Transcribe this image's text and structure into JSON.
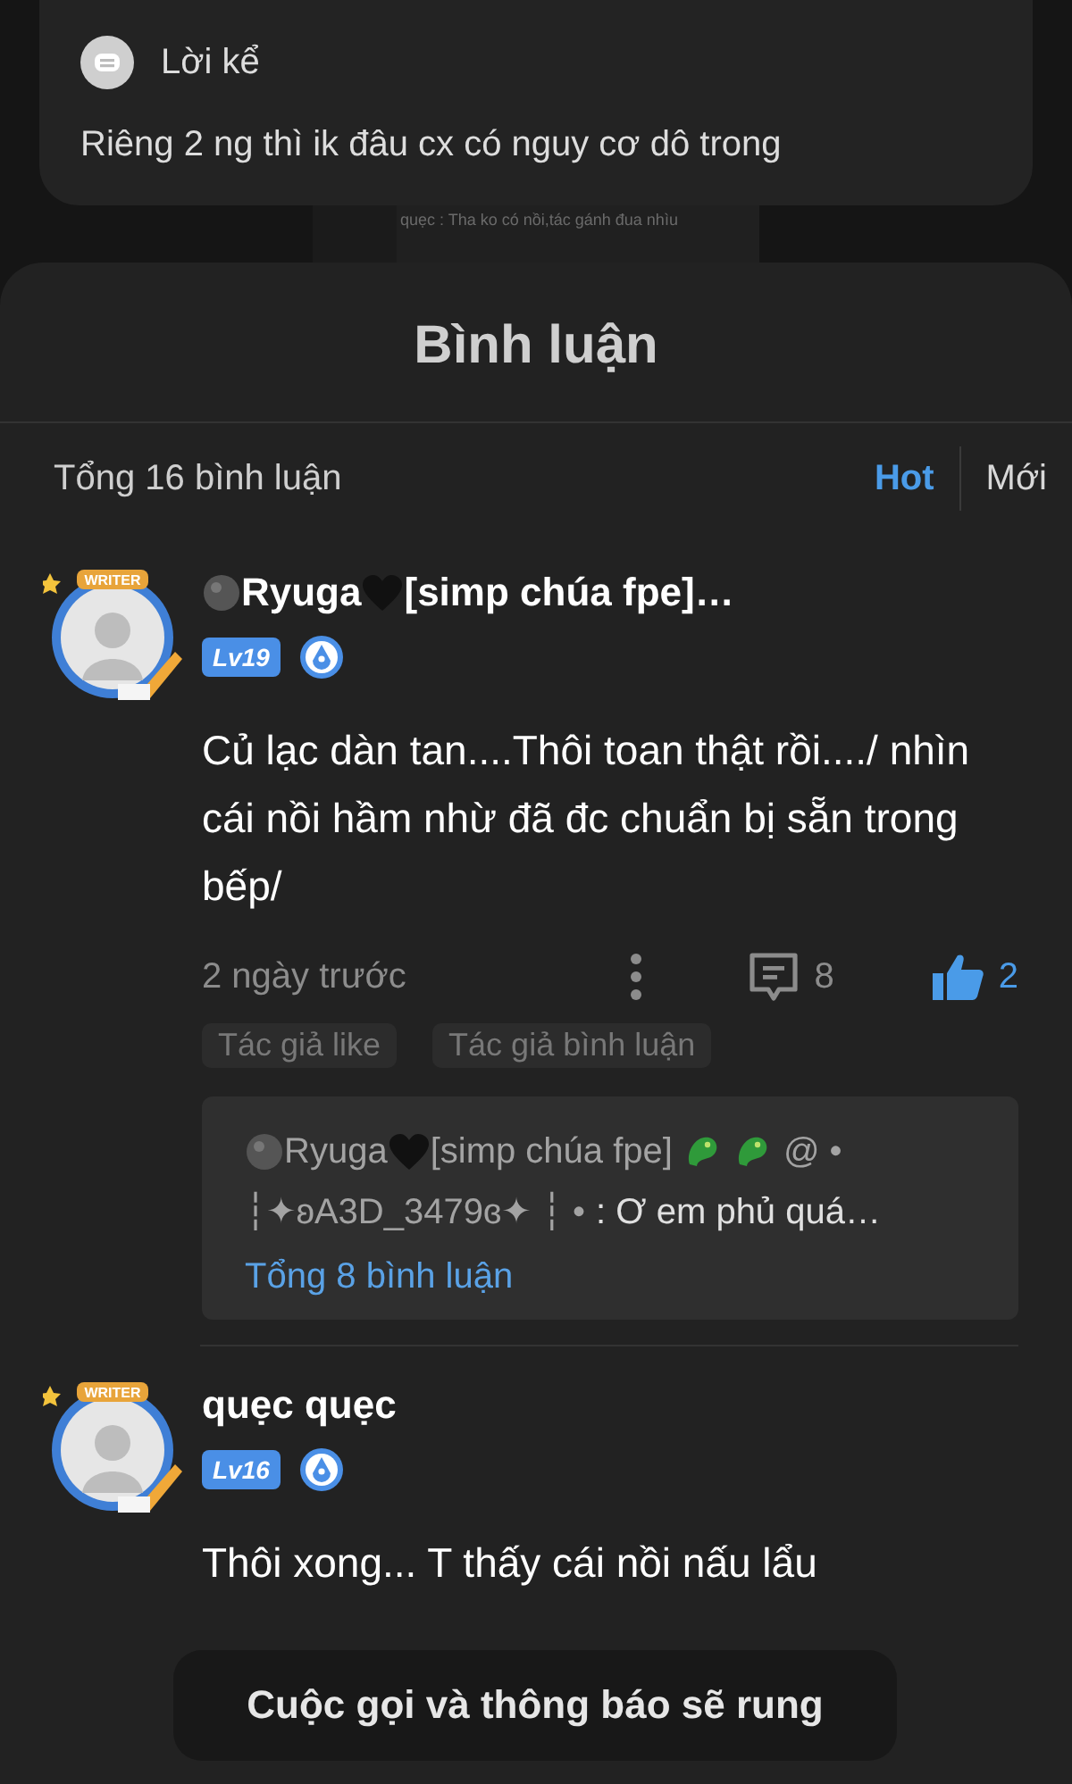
{
  "story_card": {
    "title": "Lời kể",
    "text": "Riêng 2 ng thì ik đâu cx có nguy cơ dô trong"
  },
  "background_screenshot": {
    "text": "quẹc : Tha ko có nồi,tác gánh đua nhìu"
  },
  "comments_sheet": {
    "title": "Bình luận",
    "total": "Tổng 16 bình luận",
    "sort_tabs": [
      {
        "label": "Hot",
        "selected": true
      },
      {
        "label": "Mới",
        "selected": false
      }
    ],
    "comments": [
      {
        "avatar_frame_label": "WRITER",
        "name_parts": [
          "Ryuga",
          "[simp chúa fpe]…"
        ],
        "level": "Lv19",
        "text": "Củ lạc dàn tan....Thôi toan thật rồi..../ nhìn cái nồi hầm nhừ đã đc chuẩn bị sẵn trong bếp/",
        "time": "2 ngày trước",
        "reply_count": "8",
        "like_count": "2",
        "liked": true,
        "tags": [
          "Tác giả like",
          "Tác giả bình luận"
        ],
        "reply_preview": {
          "author_parts": [
            "Ryuga",
            "[simp chúa fpe]"
          ],
          "author_suffix": "@ •",
          "mention": "┆✦ʚA3D_3479ɞ✦ ┆ •",
          "text": ": Ơ em phủ quá…",
          "link": "Tổng 8 bình luận"
        }
      },
      {
        "avatar_frame_label": "WRITER",
        "name_parts": [
          "quẹc quẹc"
        ],
        "level": "Lv16",
        "text": "Thôi xong... T thấy cái nồi nấu lẩu"
      }
    ]
  },
  "toast": {
    "text": "Cuộc gọi và thông báo sẽ rung"
  }
}
